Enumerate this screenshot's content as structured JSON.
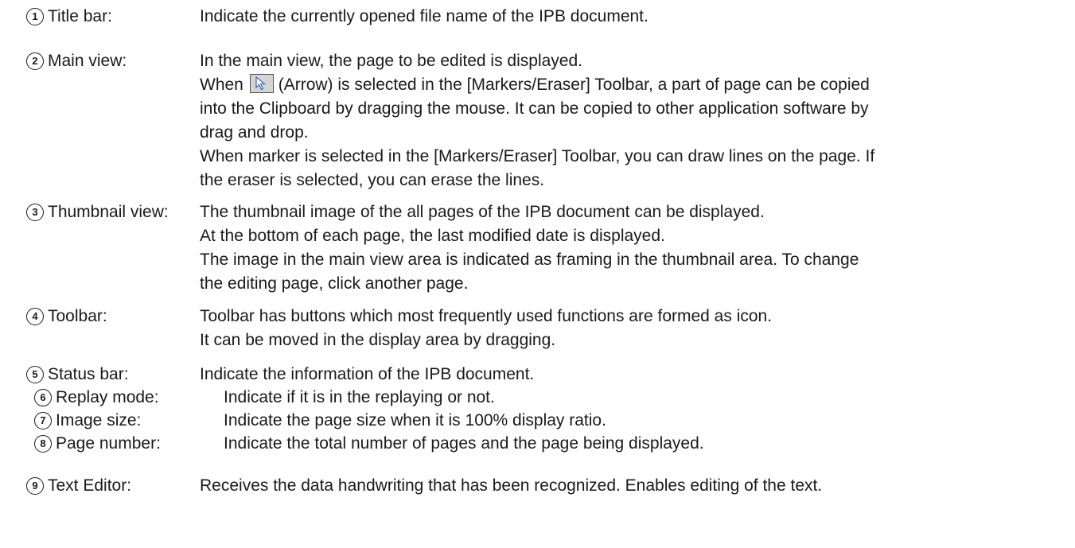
{
  "entries": [
    {
      "num": "1",
      "term": "Title bar:",
      "lines": [
        "Indicate the currently opened file name of the IPB document."
      ]
    },
    {
      "num": "2",
      "term": "Main view:",
      "lines": [
        "In the main view, the page to be edited is displayed.",
        "(Arrow) is selected in the [Markers/Eraser] Toolbar, a part of page can be copied",
        "into the Clipboard by dragging the mouse. It can be copied to other application software by",
        "drag and drop.",
        "When marker is selected in the [Markers/Eraser] Toolbar, you can draw lines on the page. If",
        "the eraser is selected, you can erase the lines."
      ],
      "when_prefix": "When"
    },
    {
      "num": "3",
      "term": "Thumbnail view:",
      "lines": [
        "The thumbnail image of the all pages of the IPB document can be displayed.",
        "At the bottom of each page, the last modified date is displayed.",
        "The image in the main view area is indicated as framing in the thumbnail area. To change",
        "the editing page, click another page."
      ]
    },
    {
      "num": "4",
      "term": "Toolbar:",
      "lines": [
        "Toolbar has buttons which most frequently used functions are formed as icon.",
        "It can be moved in the display area by dragging."
      ]
    },
    {
      "num": "5",
      "term": "Status bar:",
      "lines": [
        "Indicate the information of the IPB document."
      ]
    },
    {
      "num": "6",
      "term": "Replay mode:",
      "lines": [
        "Indicate if it is in the replaying or not."
      ]
    },
    {
      "num": "7",
      "term": "Image size:",
      "lines": [
        "Indicate the page size when it is 100% display ratio."
      ]
    },
    {
      "num": "8",
      "term": "Page number:",
      "lines": [
        "Indicate the total number of pages and the page being displayed."
      ]
    },
    {
      "num": "9",
      "term": "Text Editor:",
      "lines": [
        "Receives the data handwriting that has been recognized. Enables editing of the text."
      ]
    }
  ]
}
